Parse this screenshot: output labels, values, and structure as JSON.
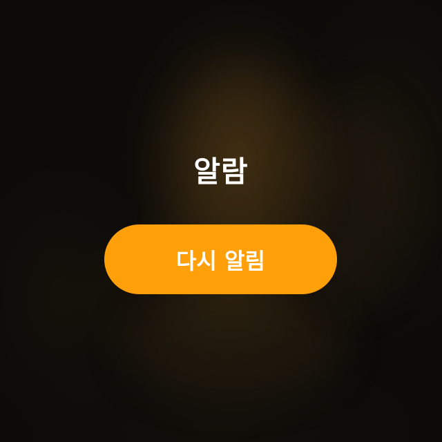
{
  "alarm": {
    "title": "알람",
    "snooze_label": "다시 알림"
  },
  "colors": {
    "snooze_button": "#ff9f0a",
    "title_text": "#ffffff",
    "background": "#0c0b09"
  }
}
